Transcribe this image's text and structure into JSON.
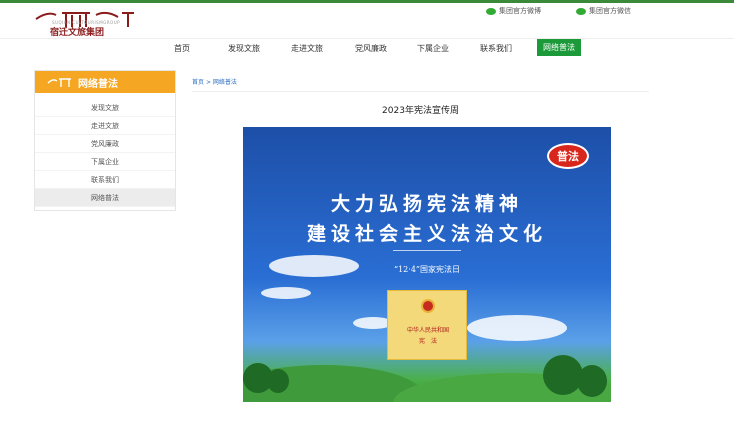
{
  "header": {
    "logo_name": "宿迁文旅集团",
    "logo_sub": "SUQIAN CULTOURISMGROUP",
    "social": [
      {
        "label": "集团官方微博",
        "icon": "weibo-icon"
      },
      {
        "label": "集团官方微信",
        "icon": "wechat-icon"
      }
    ]
  },
  "nav": {
    "items": [
      {
        "label": "首页"
      },
      {
        "label": "发现文旅"
      },
      {
        "label": "走进文旅"
      },
      {
        "label": "党风廉政"
      },
      {
        "label": "下属企业"
      },
      {
        "label": "联系我们"
      },
      {
        "label": "网络普法"
      }
    ],
    "active": "网络普法"
  },
  "sidebar": {
    "title": "网络普法",
    "items": [
      {
        "label": "发现文旅"
      },
      {
        "label": "走进文旅"
      },
      {
        "label": "党风廉政"
      },
      {
        "label": "下属企业"
      },
      {
        "label": "联系我们"
      },
      {
        "label": "网络普法"
      }
    ]
  },
  "breadcrumb": {
    "home": "首页",
    "sep": ">",
    "current": "网络普法"
  },
  "article": {
    "title": "2023年宪法宣传周",
    "poster": {
      "headline1": "大力弘扬宪法精神",
      "headline2": "建设社会主义法治文化",
      "subline": "“12·4”国家宪法日",
      "book_line1": "中华人民共和国",
      "book_line2": "宪　法",
      "badge": "普法"
    }
  },
  "colors": {
    "accent_green": "#1c9a3a",
    "sidebar_orange": "#f5a623",
    "link_blue": "#2b6cbf"
  }
}
